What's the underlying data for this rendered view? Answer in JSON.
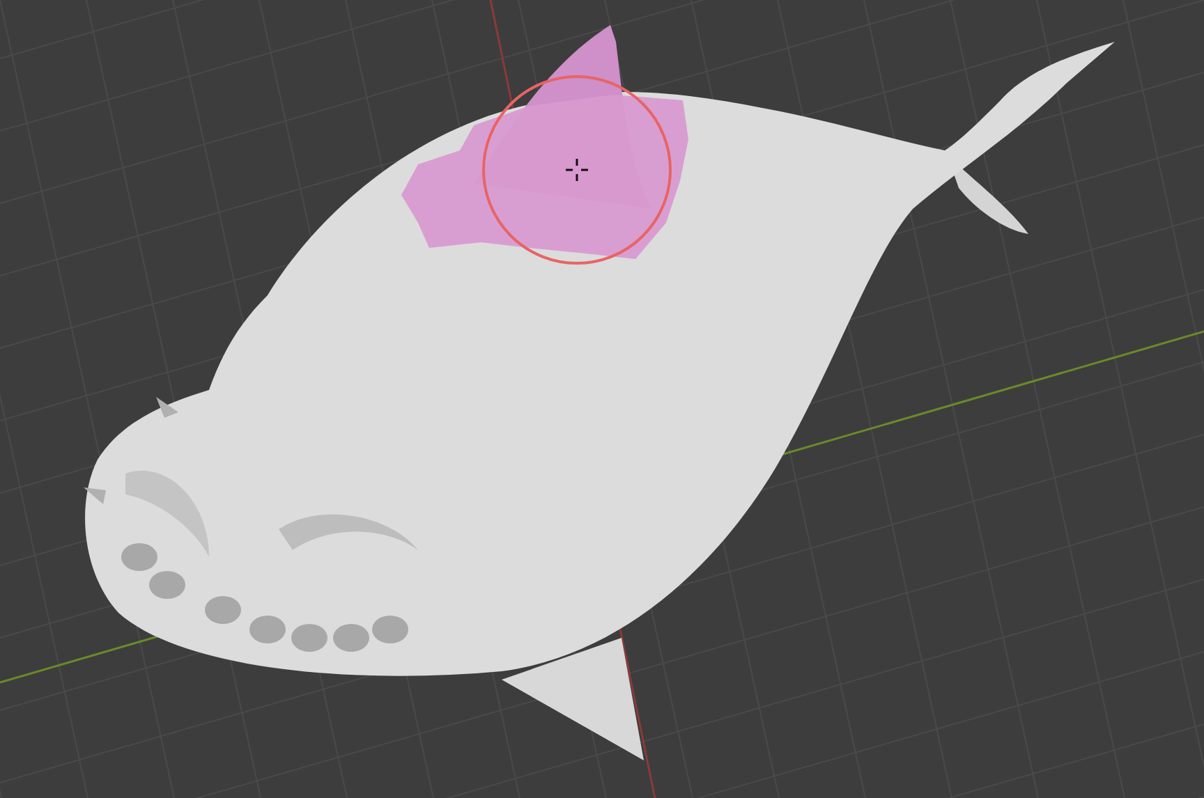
{
  "viewport": {
    "grid_visible": true,
    "mask_visible": true,
    "brush_visible": true
  }
}
